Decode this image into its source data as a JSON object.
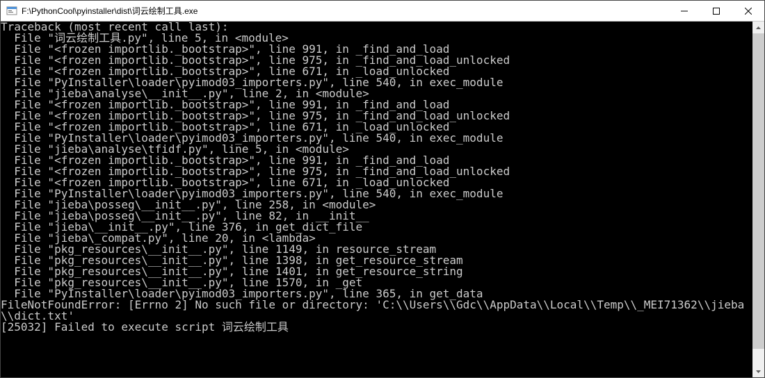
{
  "window": {
    "title": "F:\\PythonCool\\pyinstaller\\dist\\词云绘制工具.exe"
  },
  "console": {
    "lines": [
      "Traceback (most recent call last):",
      "  File \"词云绘制工具.py\", line 5, in <module>",
      "  File \"<frozen importlib._bootstrap>\", line 991, in _find_and_load",
      "  File \"<frozen importlib._bootstrap>\", line 975, in _find_and_load_unlocked",
      "  File \"<frozen importlib._bootstrap>\", line 671, in _load_unlocked",
      "  File \"PyInstaller\\loader\\pyimod03_importers.py\", line 540, in exec_module",
      "  File \"jieba\\analyse\\__init__.py\", line 2, in <module>",
      "  File \"<frozen importlib._bootstrap>\", line 991, in _find_and_load",
      "  File \"<frozen importlib._bootstrap>\", line 975, in _find_and_load_unlocked",
      "  File \"<frozen importlib._bootstrap>\", line 671, in _load_unlocked",
      "  File \"PyInstaller\\loader\\pyimod03_importers.py\", line 540, in exec_module",
      "  File \"jieba\\analyse\\tfidf.py\", line 5, in <module>",
      "  File \"<frozen importlib._bootstrap>\", line 991, in _find_and_load",
      "  File \"<frozen importlib._bootstrap>\", line 975, in _find_and_load_unlocked",
      "  File \"<frozen importlib._bootstrap>\", line 671, in _load_unlocked",
      "  File \"PyInstaller\\loader\\pyimod03_importers.py\", line 540, in exec_module",
      "  File \"jieba\\posseg\\__init__.py\", line 258, in <module>",
      "  File \"jieba\\posseg\\__init__.py\", line 82, in __init__",
      "  File \"jieba\\__init__.py\", line 376, in get_dict_file",
      "  File \"jieba\\_compat.py\", line 20, in <lambda>",
      "  File \"pkg_resources\\__init__.py\", line 1149, in resource_stream",
      "  File \"pkg_resources\\__init__.py\", line 1398, in get_resource_stream",
      "  File \"pkg_resources\\__init__.py\", line 1401, in get_resource_string",
      "  File \"pkg_resources\\__init__.py\", line 1570, in _get",
      "  File \"PyInstaller\\loader\\pyimod03_importers.py\", line 365, in get_data",
      "FileNotFoundError: [Errno 2] No such file or directory: 'C:\\\\Users\\\\Gdc\\\\AppData\\\\Local\\\\Temp\\\\_MEI71362\\\\jieba\\\\dict.txt'",
      "[25032] Failed to execute script 词云绘制工具"
    ]
  },
  "scrollbar": {
    "thumb_top_pct": 0,
    "thumb_height_pct": 95
  }
}
